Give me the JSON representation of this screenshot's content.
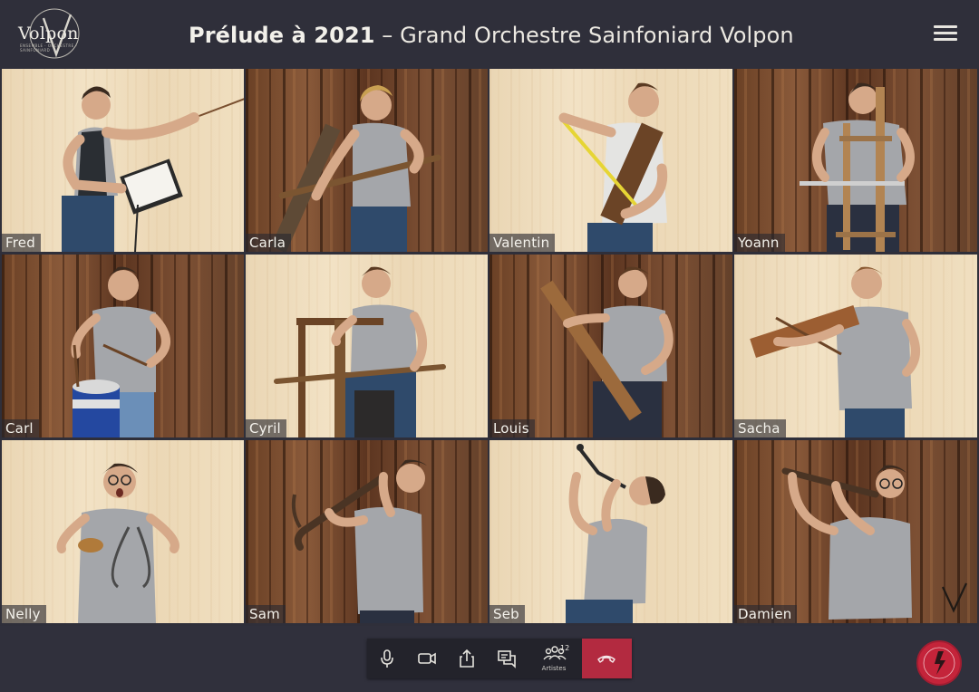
{
  "header": {
    "logo_text": "Volpon",
    "logo_subtitle": "ENSEMBLE · ORCHESTRE · SAINFONIARD",
    "title_bold": "Prélude à 2021",
    "title_rest": " – Grand Orchestre Sainfoniard Volpon",
    "menu_icon": "hamburger-menu-icon"
  },
  "participants": [
    {
      "name": "Fred",
      "background": "light"
    },
    {
      "name": "Carla",
      "background": "dark"
    },
    {
      "name": "Valentin",
      "background": "light"
    },
    {
      "name": "Yoann",
      "background": "dark"
    },
    {
      "name": "Carl",
      "background": "dark"
    },
    {
      "name": "Cyril",
      "background": "light"
    },
    {
      "name": "Louis",
      "background": "dark"
    },
    {
      "name": "Sacha",
      "background": "light"
    },
    {
      "name": "Nelly",
      "background": "light"
    },
    {
      "name": "Sam",
      "background": "dark"
    },
    {
      "name": "Seb",
      "background": "light"
    },
    {
      "name": "Damien",
      "background": "dark"
    }
  ],
  "toolbar": {
    "mic_icon": "microphone-icon",
    "camera_icon": "camera-icon",
    "share_icon": "share-icon",
    "chat_icon": "chat-icon",
    "participants_icon": "people-icon",
    "participants_count": "12",
    "participants_label": "Artistes",
    "hangup_icon": "hang-up-icon"
  },
  "colors": {
    "background": "#2f2f3a",
    "toolbar": "#23232b",
    "hangup": "#b32a40",
    "seal": "#c4243a",
    "shirt": "#a4a6aa",
    "jeans": "#2f4a6b"
  }
}
